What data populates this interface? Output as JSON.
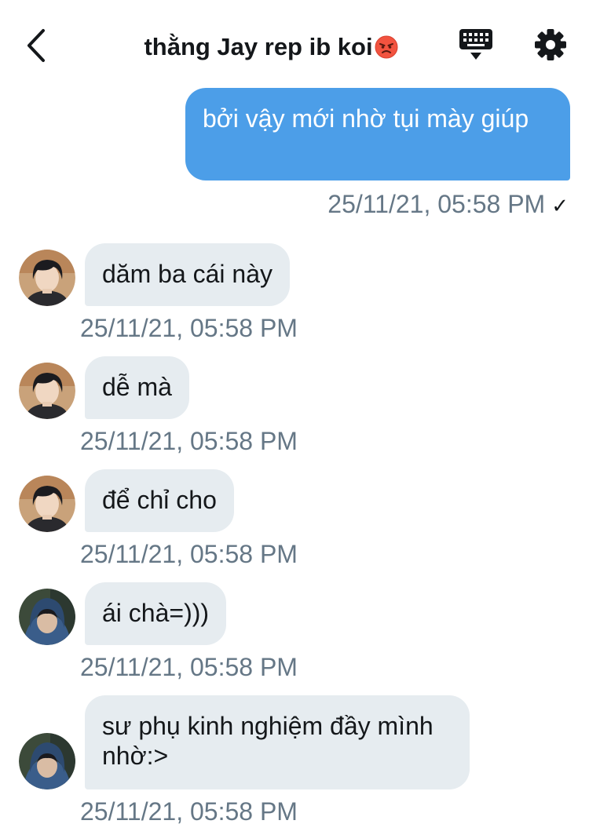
{
  "header": {
    "title": "thằng Jay rep ib koi",
    "title_emoji": "angry-face-emoji",
    "back_icon": "chevron-left-icon",
    "keyboard_icon": "keyboard-icon",
    "settings_icon": "gear-icon"
  },
  "colors": {
    "outgoing_bubble": "#4c9ee8",
    "incoming_bubble": "#e6ecf0",
    "timestamp": "#657786"
  },
  "messages": [
    {
      "direction": "outgoing",
      "text": "bởi vậy mới nhờ tụi mày giúp",
      "time": "25/11/21, 05:58 PM",
      "status": "✓"
    },
    {
      "direction": "incoming",
      "text": "dăm ba cái này",
      "time": "25/11/21, 05:58 PM",
      "avatar": "avatar-photo-1"
    },
    {
      "direction": "incoming",
      "text": "dễ mà",
      "time": "25/11/21, 05:58 PM",
      "avatar": "avatar-photo-1"
    },
    {
      "direction": "incoming",
      "text": "để chỉ cho",
      "time": "25/11/21, 05:58 PM",
      "avatar": "avatar-photo-1"
    },
    {
      "direction": "incoming",
      "text": "ái chà=)))",
      "time": "25/11/21, 05:58 PM",
      "avatar": "avatar-photo-2"
    },
    {
      "direction": "incoming",
      "text": "sư phụ kinh nghiệm đầy mình nhờ:>",
      "time": "25/11/21, 05:58 PM",
      "avatar": "avatar-photo-2"
    }
  ]
}
